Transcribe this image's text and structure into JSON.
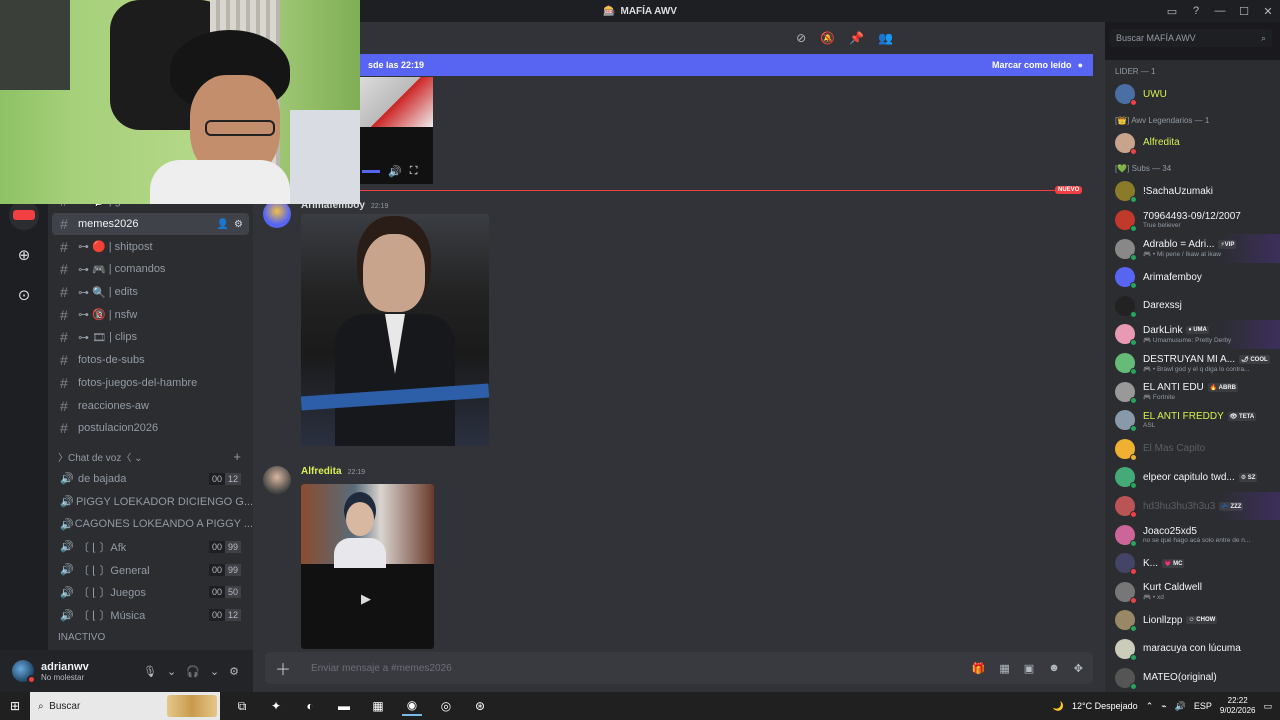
{
  "window": {
    "title": "MAFÍA AWV",
    "controls": [
      "▭",
      "?",
      "—",
      "☐",
      "✕"
    ]
  },
  "header": {
    "icons": [
      "threads-icon",
      "mute-icon",
      "pin-icon",
      "members-icon"
    ],
    "glyphs": [
      "⊘",
      "🔕",
      "📌",
      "👥"
    ]
  },
  "search": {
    "placeholder": "Buscar MAFÍA AWV",
    "icon": "⌕"
  },
  "banner": {
    "text": "sde las 22:19",
    "action": "Marcar como leído"
  },
  "new_marker": "NUEVO",
  "rail": {
    "items": [
      "⊕",
      "⊙"
    ]
  },
  "channels": {
    "text": [
      {
        "label": "| general",
        "emoji": "⊶ 💬"
      },
      {
        "label": "memes2026",
        "active": true
      },
      {
        "label": "| shitpost",
        "emoji": "⊶ 🔴"
      },
      {
        "label": "| comandos",
        "emoji": "⊶ 🎮"
      },
      {
        "label": "| edits",
        "emoji": "⊶ 🔍"
      },
      {
        "label": "| nsfw",
        "emoji": "⊶ 🔞"
      },
      {
        "label": "| clips",
        "emoji": "⊶ 🎞"
      },
      {
        "label": "fotos-de-subs"
      },
      {
        "label": "fotos-juegos-del-hambre"
      },
      {
        "label": "reacciones-aw"
      },
      {
        "label": "postulacion2026"
      }
    ],
    "voice_category": "〉Chat de voz〈 ⌄",
    "voice": [
      {
        "label": "de bajada",
        "a": "00",
        "b": "12"
      },
      {
        "label": "PIGGY LOEKADOR DICIENGO G..."
      },
      {
        "label": "CAGONES LOKEANDO A PIGGY ..."
      },
      {
        "label": "〔 ⌊ 〕Afk",
        "a": "00",
        "b": "99"
      },
      {
        "label": "〔 ⌊ 〕General",
        "a": "00",
        "b": "99"
      },
      {
        "label": "〔 ⌊ 〕Juegos",
        "a": "00",
        "b": "50"
      },
      {
        "label": "〔 ⌊ 〕Música",
        "a": "00",
        "b": "12"
      }
    ],
    "inactive": "INACTIVO"
  },
  "user": {
    "name": "adrianwv",
    "status": "No molestar"
  },
  "messages": [
    {
      "author": "Arimafemboy",
      "time": "22:19",
      "color": "#dbdee1"
    },
    {
      "author": "Alfredita",
      "time": "22:19",
      "color": "#d9ef52"
    }
  ],
  "composer": {
    "placeholder": "Enviar mensaje a #memes2026"
  },
  "members": {
    "groups": [
      {
        "header": "LIDER — 1",
        "items": [
          {
            "name": "UWU",
            "color": "#d9ef52",
            "av": "#4a6fa5",
            "st": "#f23f43"
          }
        ]
      },
      {
        "header": "[👑] Awv Legendarios — 1",
        "items": [
          {
            "name": "Alfredita",
            "color": "#d9ef52",
            "av": "#c9a48c",
            "st": "#f23f43"
          }
        ]
      },
      {
        "header": "[💚] Subs — 34",
        "items": [
          {
            "name": "!SachaUzumaki",
            "av": "#8a7a2a",
            "st": "#23a55a"
          },
          {
            "name": "70964493-09/12/2007",
            "sub": "True believer",
            "av": "#c0392b",
            "st": "#23a55a"
          },
          {
            "name": "Adrablo = Adri...",
            "tag": "⚡VIP",
            "sub": "🎮 • Mi pene / Ikaw at ikaw",
            "av": "#888",
            "st": "#23a55a",
            "boost": true
          },
          {
            "name": "Arimafemboy",
            "av": "#5865f2",
            "st": "#23a55a"
          },
          {
            "name": "Darexssj",
            "av": "#222",
            "st": "#23a55a"
          },
          {
            "name": "DarkLink",
            "tag": "♦ UMA",
            "sub": "🎮 Umamusume: Pretty Derby",
            "av": "#e89ab5",
            "st": "#23a55a",
            "boost": true
          },
          {
            "name": "DESTRUYAN MI A...",
            "tag": "🌶 COOL",
            "sub": "🎮 • Brawl god y el q diga lo contra...",
            "av": "#6b7",
            "st": "#23a55a"
          },
          {
            "name": "EL ANTI EDU",
            "tag": "🔥 ABRB",
            "sub": "🎮 Fortnite",
            "av": "#999",
            "st": "#23a55a"
          },
          {
            "name": "EL ANTI FREDDY",
            "tag": "👁 TETA",
            "sub": "ASL",
            "color": "#d9ef52",
            "av": "#8899aa",
            "st": "#23a55a"
          },
          {
            "name": "El Mas Capito",
            "color": "#5c5e66",
            "av": "#f0b132",
            "st": "#f0b132"
          },
          {
            "name": "elpeor capitulo twd...",
            "tag": "⚙ SZ",
            "av": "#4a7",
            "st": "#23a55a"
          },
          {
            "name": "hd3hu3hu3h3u3",
            "tag": "💤 ZZZ",
            "color": "#5c5e66",
            "av": "#b55",
            "st": "#f23f43",
            "boost": true
          },
          {
            "name": "Joaco25xd5",
            "sub": "no se qué hago acá solo entre de n...",
            "av": "#c69",
            "st": "#23a55a"
          },
          {
            "name": "K...",
            "tag": "💗 MC",
            "av": "#446",
            "st": "#f23f43"
          },
          {
            "name": "Kurt Caldwell",
            "sub": "🎮 • xd",
            "av": "#777",
            "st": "#f23f43"
          },
          {
            "name": "Lionllzpp",
            "tag": "☺ CHOW",
            "av": "#986",
            "st": "#23a55a"
          },
          {
            "name": "maracuya con lúcuma",
            "av": "#ccb",
            "st": "#23a55a"
          },
          {
            "name": "MATEO(original)",
            "av": "#555",
            "st": "#23a55a"
          }
        ]
      }
    ]
  },
  "taskbar": {
    "search": "Buscar",
    "apps": [
      "⧉",
      "✦",
      "◐",
      "▬",
      "▦",
      "◉",
      "◎",
      "⊛"
    ],
    "weather": "12°C  Despejado",
    "lang": "ESP",
    "time": "22:22",
    "date": "9/02/2026"
  }
}
